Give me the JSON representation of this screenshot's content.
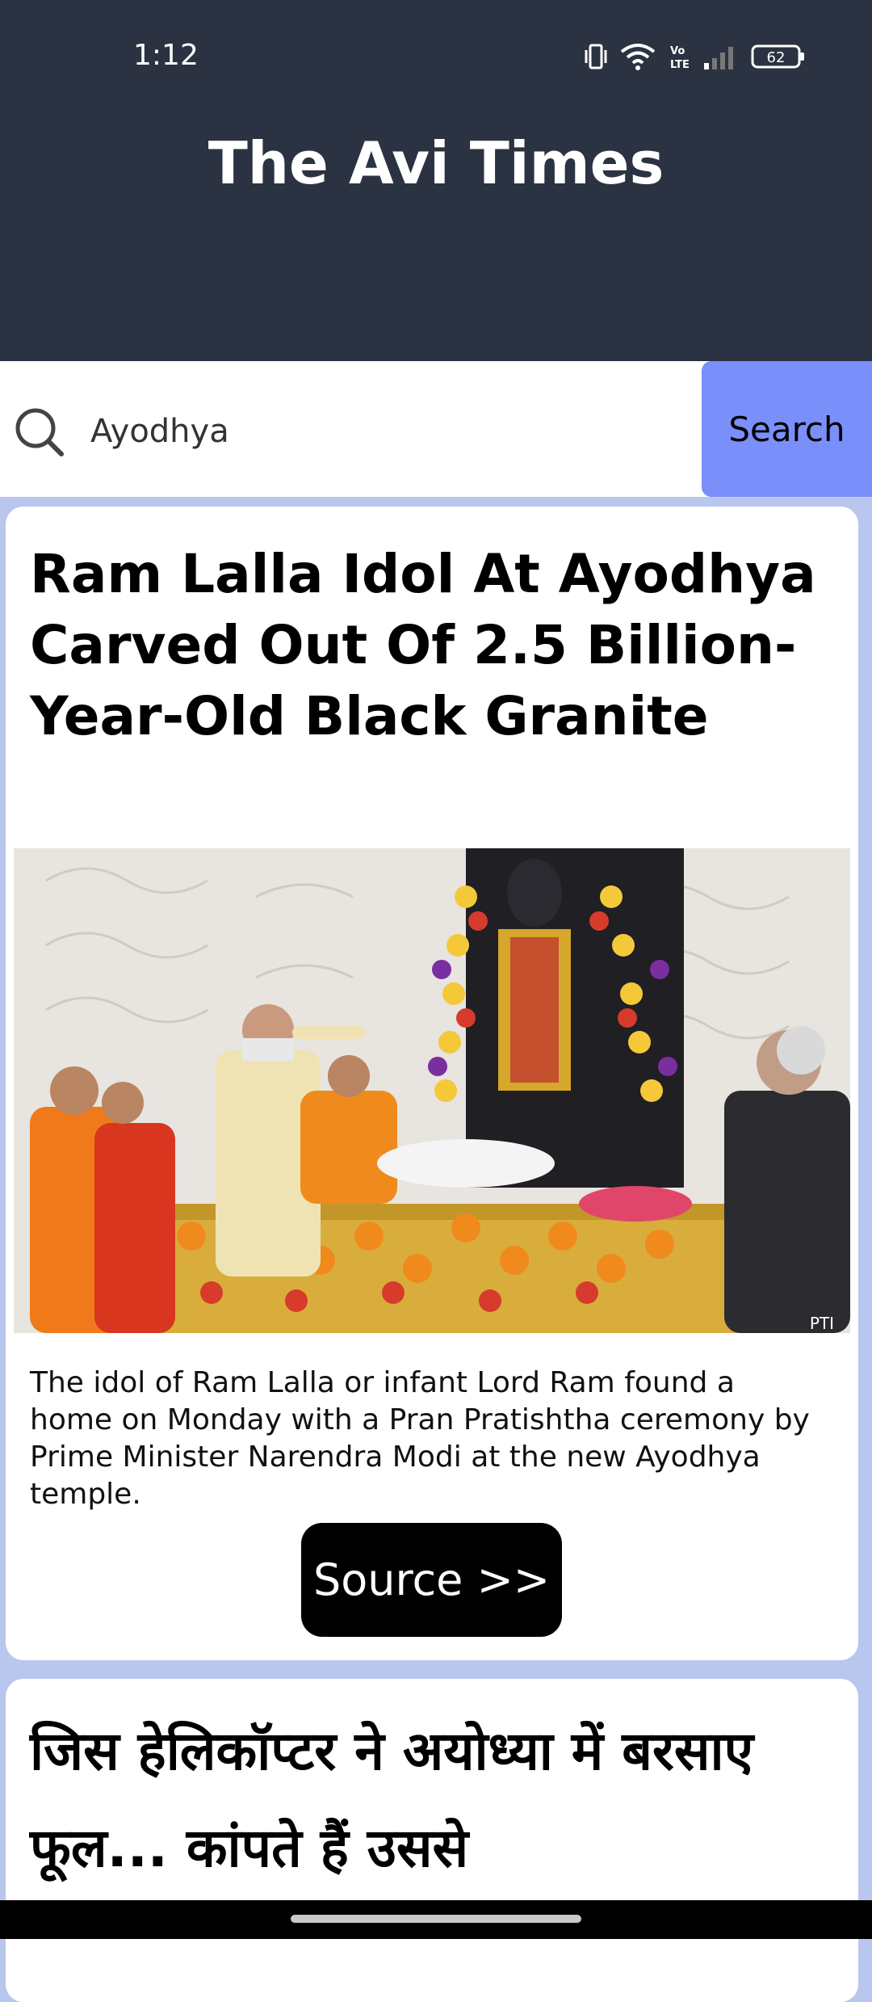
{
  "status_bar": {
    "time": "1:12",
    "battery": "62",
    "volte_label": "Vo LTE"
  },
  "header": {
    "title": "The Avi Times"
  },
  "search": {
    "value": "Ayodhya",
    "button_label": "Search"
  },
  "articles": [
    {
      "title": "Ram Lalla Idol At Ayodhya Carved Out Of 2.5 Billion-Year-Old Black Granite",
      "image_credit": "PTI",
      "description": "The idol of Ram Lalla or infant Lord Ram found a home on Monday with a Pran Pratishtha ceremony by Prime Minister Narendra Modi at the new Ayodhya temple.",
      "source_label": "Source >>"
    },
    {
      "title": "जिस हेलिकॉप्टर ने अयोध्या में बरसाए फूल... कांपते हैं उससे"
    }
  ],
  "colors": {
    "header_bg": "#2b3241",
    "page_bg": "#b9c7ee",
    "search_button_bg": "#7b8ffb",
    "source_button_bg": "#000000"
  }
}
